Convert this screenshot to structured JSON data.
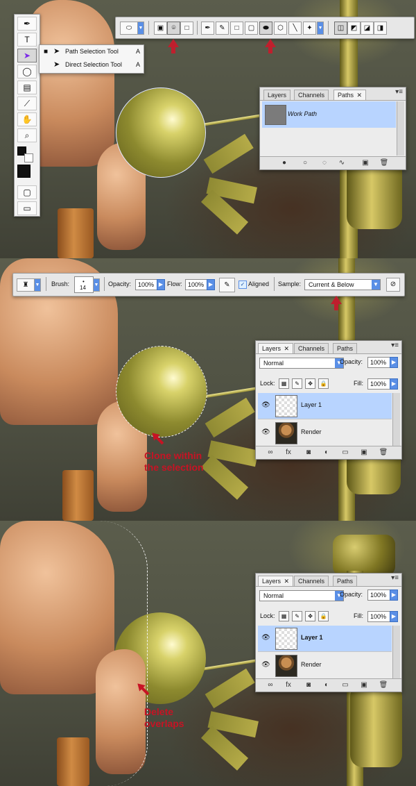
{
  "top_section": {
    "flyout": {
      "items": [
        {
          "label": "Path Selection Tool",
          "shortcut": "A"
        },
        {
          "label": "Direct Selection Tool",
          "shortcut": "A"
        }
      ]
    },
    "paths_panel": {
      "tabs": [
        "Layers",
        "Channels",
        "Paths"
      ],
      "active_tab": "Paths",
      "path_name": "Work Path"
    }
  },
  "middle_section": {
    "brush": {
      "label": "Brush:",
      "size": "14"
    },
    "opacity": {
      "label": "Opacity:",
      "value": "100%"
    },
    "flow": {
      "label": "Flow:",
      "value": "100%"
    },
    "aligned": {
      "label": "Aligned",
      "checked": true
    },
    "sample": {
      "label": "Sample:",
      "value": "Current & Below"
    },
    "layers_panel": {
      "tabs": [
        "Layers",
        "Channels",
        "Paths"
      ],
      "blend_mode": "Normal",
      "opacity_label": "Opacity:",
      "opacity": "100%",
      "lock_label": "Lock:",
      "fill_label": "Fill:",
      "fill": "100%",
      "layers": [
        "Layer 1",
        "Render"
      ]
    },
    "caption": [
      "Clone within",
      "the selection"
    ]
  },
  "bottom_section": {
    "layers_panel": {
      "tabs": [
        "Layers",
        "Channels",
        "Paths"
      ],
      "blend_mode": "Normal",
      "opacity_label": "Opacity:",
      "opacity": "100%",
      "lock_label": "Lock:",
      "fill_label": "Fill:",
      "fill": "100%",
      "layers": [
        "Layer 1",
        "Render"
      ]
    },
    "caption": [
      "Delete",
      "overlaps"
    ]
  },
  "colors": {
    "accent_red": "#c71324",
    "selection_blue": "#b8d4ff",
    "panel_gray": "#ececec"
  }
}
